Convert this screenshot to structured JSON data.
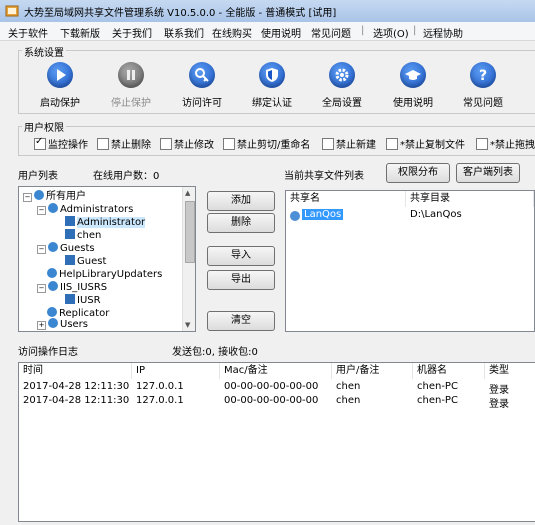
{
  "window": {
    "title": "大势至局域网共享文件管理系统 V10.5.0.0 - 全能版 - 普通模式 [试用]"
  },
  "menu": [
    "关于软件",
    "下载新版",
    "关于我们",
    "联系我们",
    "在线购买",
    "使用说明",
    "常见问题",
    "选项(O)",
    "远程协助"
  ],
  "system_settings": {
    "label": "系统设置",
    "buttons": [
      {
        "label": "启动保护",
        "icon": "play-icon"
      },
      {
        "label": "停止保护",
        "icon": "pause-icon"
      },
      {
        "label": "访问许可",
        "icon": "key-icon"
      },
      {
        "label": "绑定认证",
        "icon": "shield-icon"
      },
      {
        "label": "全局设置",
        "icon": "gear-icon"
      },
      {
        "label": "使用说明",
        "icon": "graduation-cap-icon"
      },
      {
        "label": "常见问题",
        "icon": "question-icon"
      }
    ]
  },
  "user_permissions": {
    "label": "用户权限",
    "checks": [
      {
        "label": "监控操作",
        "checked": true
      },
      {
        "label": "禁止删除",
        "checked": false
      },
      {
        "label": "禁止修改",
        "checked": false
      },
      {
        "label": "禁止剪切/重命名",
        "checked": false
      },
      {
        "label": "禁止新建",
        "checked": false
      },
      {
        "label": "*禁止复制文件",
        "checked": false
      },
      {
        "label": "*禁止拖拽文",
        "checked": false
      }
    ]
  },
  "users": {
    "list_label": "用户列表",
    "online_label": "在线用户数：0",
    "tree": [
      {
        "label": "所有用户",
        "level": 0
      },
      {
        "label": "Administrators",
        "level": 1
      },
      {
        "label": "Administrator",
        "level": 2,
        "selected": true
      },
      {
        "label": "chen",
        "level": 2
      },
      {
        "label": "Guests",
        "level": 1
      },
      {
        "label": "Guest",
        "level": 2
      },
      {
        "label": "HelpLibraryUpdaters",
        "level": 1
      },
      {
        "label": "IIS_IUSRS",
        "level": 1
      },
      {
        "label": "IUSR",
        "level": 2
      },
      {
        "label": "Replicator",
        "level": 1
      },
      {
        "label": "Users",
        "level": 1
      }
    ]
  },
  "actions": {
    "add": "添加",
    "delete": "删除",
    "import": "导入",
    "export": "导出",
    "clear": "清空"
  },
  "shares": {
    "label": "当前共享文件列表",
    "perm_button": "权限分布",
    "client_button": "客户端列表",
    "headers": [
      "共享名",
      "共享目录"
    ],
    "rows": [
      {
        "name": "LanQos",
        "path": "D:\\LanQos"
      }
    ]
  },
  "log": {
    "label": "访问操作日志",
    "packets": "发送包:0, 接收包:0",
    "headers": [
      "时间",
      "IP",
      "Mac/备注",
      "用户/备注",
      "机器名",
      "类型"
    ],
    "rows": [
      {
        "time": "2017-04-28 12:11:30",
        "ip": "127.0.0.1",
        "mac": "00-00-00-00-00-00",
        "user": "chen",
        "machine": "chen-PC",
        "type": "登录"
      },
      {
        "time": "2017-04-28 12:11:30",
        "ip": "127.0.0.1",
        "mac": "00-00-00-00-00-00",
        "user": "chen",
        "machine": "chen-PC",
        "type": "登录"
      }
    ]
  }
}
